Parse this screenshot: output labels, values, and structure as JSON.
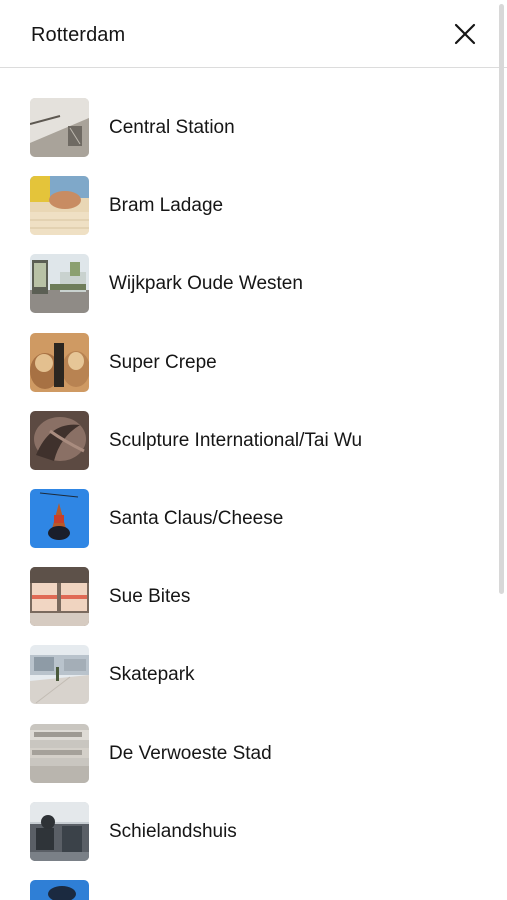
{
  "header": {
    "title": "Rotterdam",
    "close_icon": "close-icon"
  },
  "places": [
    {
      "label": "Central Station",
      "thumb": "central-station-photo"
    },
    {
      "label": "Bram Ladage",
      "thumb": "bram-ladage-photo"
    },
    {
      "label": "Wijkpark Oude Westen",
      "thumb": "wijkpark-photo"
    },
    {
      "label": "Super Crepe",
      "thumb": "super-crepe-photo"
    },
    {
      "label": "Sculpture International/Tai Wu",
      "thumb": "sculpture-photo"
    },
    {
      "label": "Santa Claus/Cheese",
      "thumb": "santa-claus-photo"
    },
    {
      "label": "Sue Bites",
      "thumb": "sue-bites-photo"
    },
    {
      "label": "Skatepark",
      "thumb": "skatepark-photo"
    },
    {
      "label": "De Verwoeste Stad",
      "thumb": "verwoeste-stad-photo"
    },
    {
      "label": "Schielandshuis",
      "thumb": "schielandshuis-photo"
    }
  ],
  "colors": {
    "text": "#161616",
    "divider": "#dcdcdc",
    "scrollbar": "#d8d8d8"
  }
}
